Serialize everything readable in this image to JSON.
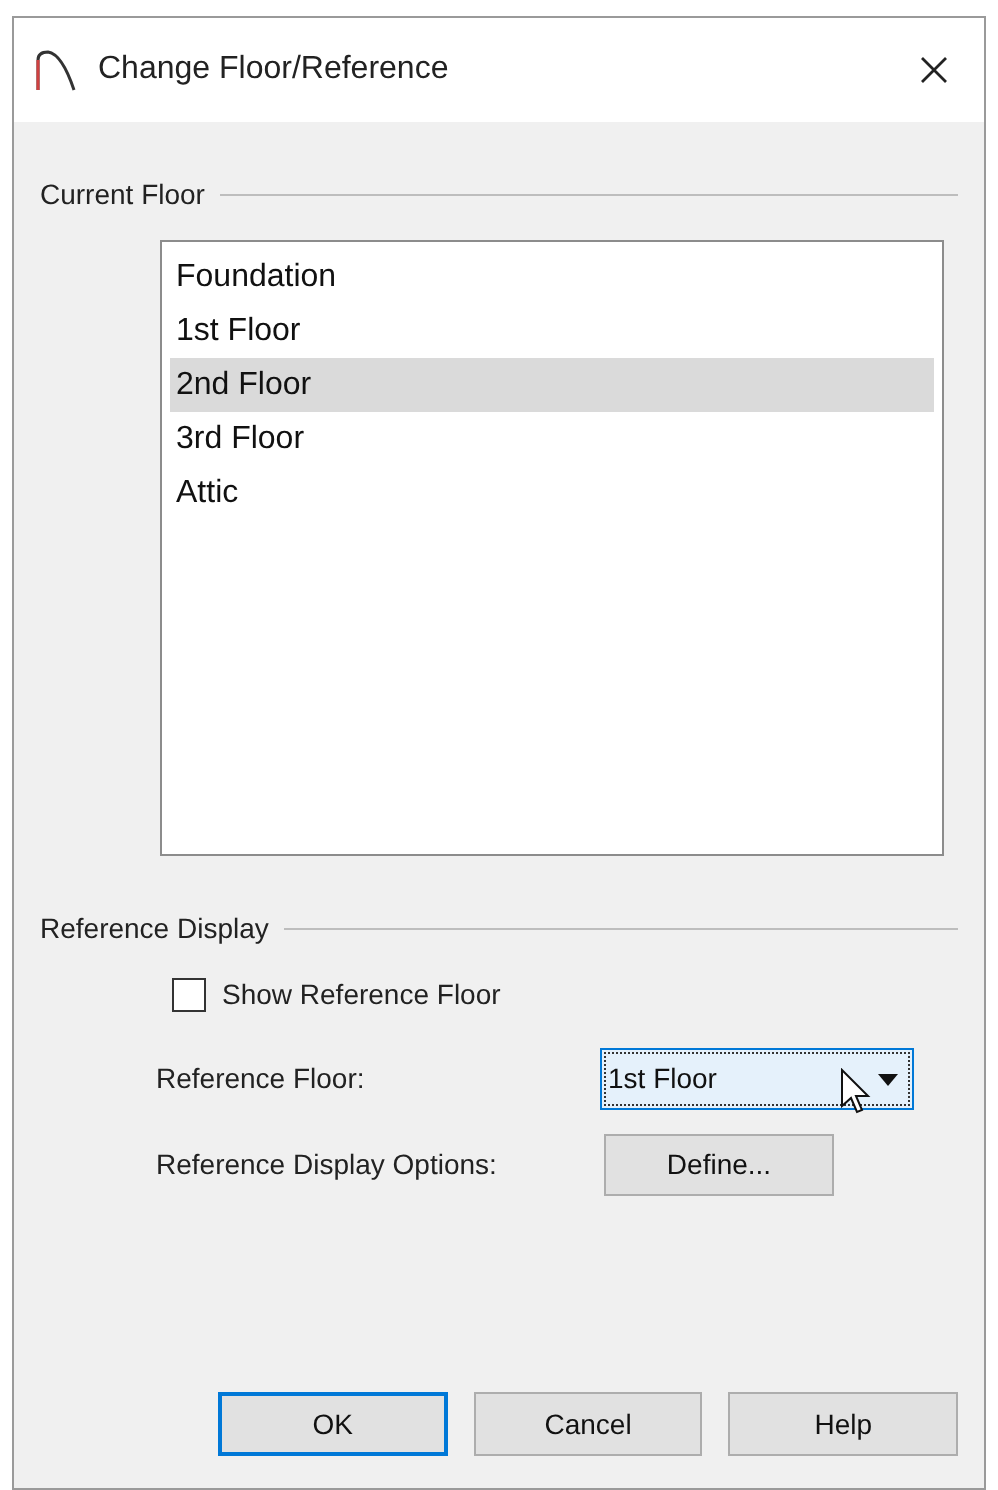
{
  "window": {
    "title": "Change Floor/Reference"
  },
  "current_floor": {
    "label": "Current Floor",
    "items": [
      {
        "label": "Foundation",
        "selected": false
      },
      {
        "label": "1st Floor",
        "selected": false
      },
      {
        "label": "2nd Floor",
        "selected": true
      },
      {
        "label": "3rd Floor",
        "selected": false
      },
      {
        "label": "Attic",
        "selected": false
      }
    ]
  },
  "reference_display": {
    "label": "Reference Display",
    "show_reference_floor": {
      "label": "Show Reference Floor",
      "checked": false
    },
    "reference_floor": {
      "label": "Reference Floor:",
      "value": "1st Floor",
      "focused": true
    },
    "display_options": {
      "label": "Reference Display Options:",
      "button": "Define..."
    }
  },
  "buttons": [
    {
      "label": "OK",
      "default": true
    },
    {
      "label": "Cancel",
      "default": false
    },
    {
      "label": "Help",
      "default": false
    }
  ]
}
